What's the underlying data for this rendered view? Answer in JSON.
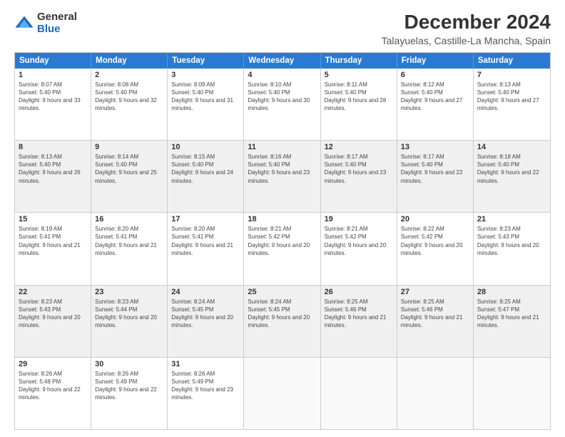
{
  "logo": {
    "general": "General",
    "blue": "Blue"
  },
  "title": "December 2024",
  "subtitle": "Talayuelas, Castille-La Mancha, Spain",
  "headers": [
    "Sunday",
    "Monday",
    "Tuesday",
    "Wednesday",
    "Thursday",
    "Friday",
    "Saturday"
  ],
  "weeks": [
    [
      {
        "day": "1",
        "sunrise": "8:07 AM",
        "sunset": "5:40 PM",
        "daylight": "9 hours and 33 minutes."
      },
      {
        "day": "2",
        "sunrise": "8:08 AM",
        "sunset": "5:40 PM",
        "daylight": "9 hours and 32 minutes."
      },
      {
        "day": "3",
        "sunrise": "8:09 AM",
        "sunset": "5:40 PM",
        "daylight": "9 hours and 31 minutes."
      },
      {
        "day": "4",
        "sunrise": "8:10 AM",
        "sunset": "5:40 PM",
        "daylight": "9 hours and 30 minutes."
      },
      {
        "day": "5",
        "sunrise": "8:11 AM",
        "sunset": "5:40 PM",
        "daylight": "9 hours and 28 minutes."
      },
      {
        "day": "6",
        "sunrise": "8:12 AM",
        "sunset": "5:40 PM",
        "daylight": "9 hours and 27 minutes."
      },
      {
        "day": "7",
        "sunrise": "8:13 AM",
        "sunset": "5:40 PM",
        "daylight": "9 hours and 27 minutes."
      }
    ],
    [
      {
        "day": "8",
        "sunrise": "8:13 AM",
        "sunset": "5:40 PM",
        "daylight": "9 hours and 26 minutes."
      },
      {
        "day": "9",
        "sunrise": "8:14 AM",
        "sunset": "5:40 PM",
        "daylight": "9 hours and 25 minutes."
      },
      {
        "day": "10",
        "sunrise": "8:15 AM",
        "sunset": "5:40 PM",
        "daylight": "9 hours and 24 minutes."
      },
      {
        "day": "11",
        "sunrise": "8:16 AM",
        "sunset": "5:40 PM",
        "daylight": "9 hours and 23 minutes."
      },
      {
        "day": "12",
        "sunrise": "8:17 AM",
        "sunset": "5:40 PM",
        "daylight": "9 hours and 23 minutes."
      },
      {
        "day": "13",
        "sunrise": "8:17 AM",
        "sunset": "5:40 PM",
        "daylight": "9 hours and 22 minutes."
      },
      {
        "day": "14",
        "sunrise": "8:18 AM",
        "sunset": "5:40 PM",
        "daylight": "9 hours and 22 minutes."
      }
    ],
    [
      {
        "day": "15",
        "sunrise": "8:19 AM",
        "sunset": "5:41 PM",
        "daylight": "9 hours and 21 minutes."
      },
      {
        "day": "16",
        "sunrise": "8:20 AM",
        "sunset": "5:41 PM",
        "daylight": "9 hours and 21 minutes."
      },
      {
        "day": "17",
        "sunrise": "8:20 AM",
        "sunset": "5:41 PM",
        "daylight": "9 hours and 21 minutes."
      },
      {
        "day": "18",
        "sunrise": "8:21 AM",
        "sunset": "5:42 PM",
        "daylight": "9 hours and 20 minutes."
      },
      {
        "day": "19",
        "sunrise": "8:21 AM",
        "sunset": "5:42 PM",
        "daylight": "9 hours and 20 minutes."
      },
      {
        "day": "20",
        "sunrise": "8:22 AM",
        "sunset": "5:42 PM",
        "daylight": "9 hours and 20 minutes."
      },
      {
        "day": "21",
        "sunrise": "8:23 AM",
        "sunset": "5:43 PM",
        "daylight": "9 hours and 20 minutes."
      }
    ],
    [
      {
        "day": "22",
        "sunrise": "8:23 AM",
        "sunset": "5:43 PM",
        "daylight": "9 hours and 20 minutes."
      },
      {
        "day": "23",
        "sunrise": "8:23 AM",
        "sunset": "5:44 PM",
        "daylight": "9 hours and 20 minutes."
      },
      {
        "day": "24",
        "sunrise": "8:24 AM",
        "sunset": "5:45 PM",
        "daylight": "9 hours and 20 minutes."
      },
      {
        "day": "25",
        "sunrise": "8:24 AM",
        "sunset": "5:45 PM",
        "daylight": "9 hours and 20 minutes."
      },
      {
        "day": "26",
        "sunrise": "8:25 AM",
        "sunset": "5:46 PM",
        "daylight": "9 hours and 21 minutes."
      },
      {
        "day": "27",
        "sunrise": "8:25 AM",
        "sunset": "5:46 PM",
        "daylight": "9 hours and 21 minutes."
      },
      {
        "day": "28",
        "sunrise": "8:25 AM",
        "sunset": "5:47 PM",
        "daylight": "9 hours and 21 minutes."
      }
    ],
    [
      {
        "day": "29",
        "sunrise": "8:26 AM",
        "sunset": "5:48 PM",
        "daylight": "9 hours and 22 minutes."
      },
      {
        "day": "30",
        "sunrise": "8:26 AM",
        "sunset": "5:49 PM",
        "daylight": "9 hours and 22 minutes."
      },
      {
        "day": "31",
        "sunrise": "8:26 AM",
        "sunset": "5:49 PM",
        "daylight": "9 hours and 23 minutes."
      },
      null,
      null,
      null,
      null
    ]
  ],
  "labels": {
    "sunrise": "Sunrise: ",
    "sunset": "Sunset: ",
    "daylight": "Daylight: "
  }
}
